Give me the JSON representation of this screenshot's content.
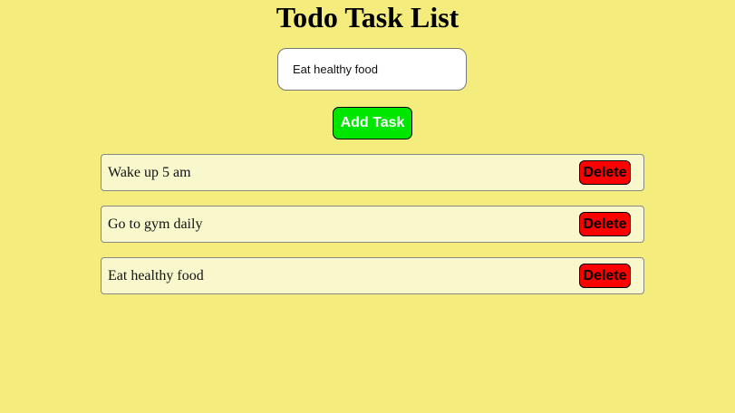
{
  "title": "Todo Task List",
  "input": {
    "value": "Eat healthy food"
  },
  "add_label": "Add Task",
  "tasks": [
    {
      "text": "Wake up 5 am",
      "delete_label": "Delete"
    },
    {
      "text": "Go to gym daily",
      "delete_label": "Delete"
    },
    {
      "text": "Eat healthy food",
      "delete_label": "Delete"
    }
  ],
  "colors": {
    "background": "#f4ec7c",
    "add_button": "#00e600",
    "delete_button": "#ff0000",
    "task_bg": "#f8f8cc"
  }
}
